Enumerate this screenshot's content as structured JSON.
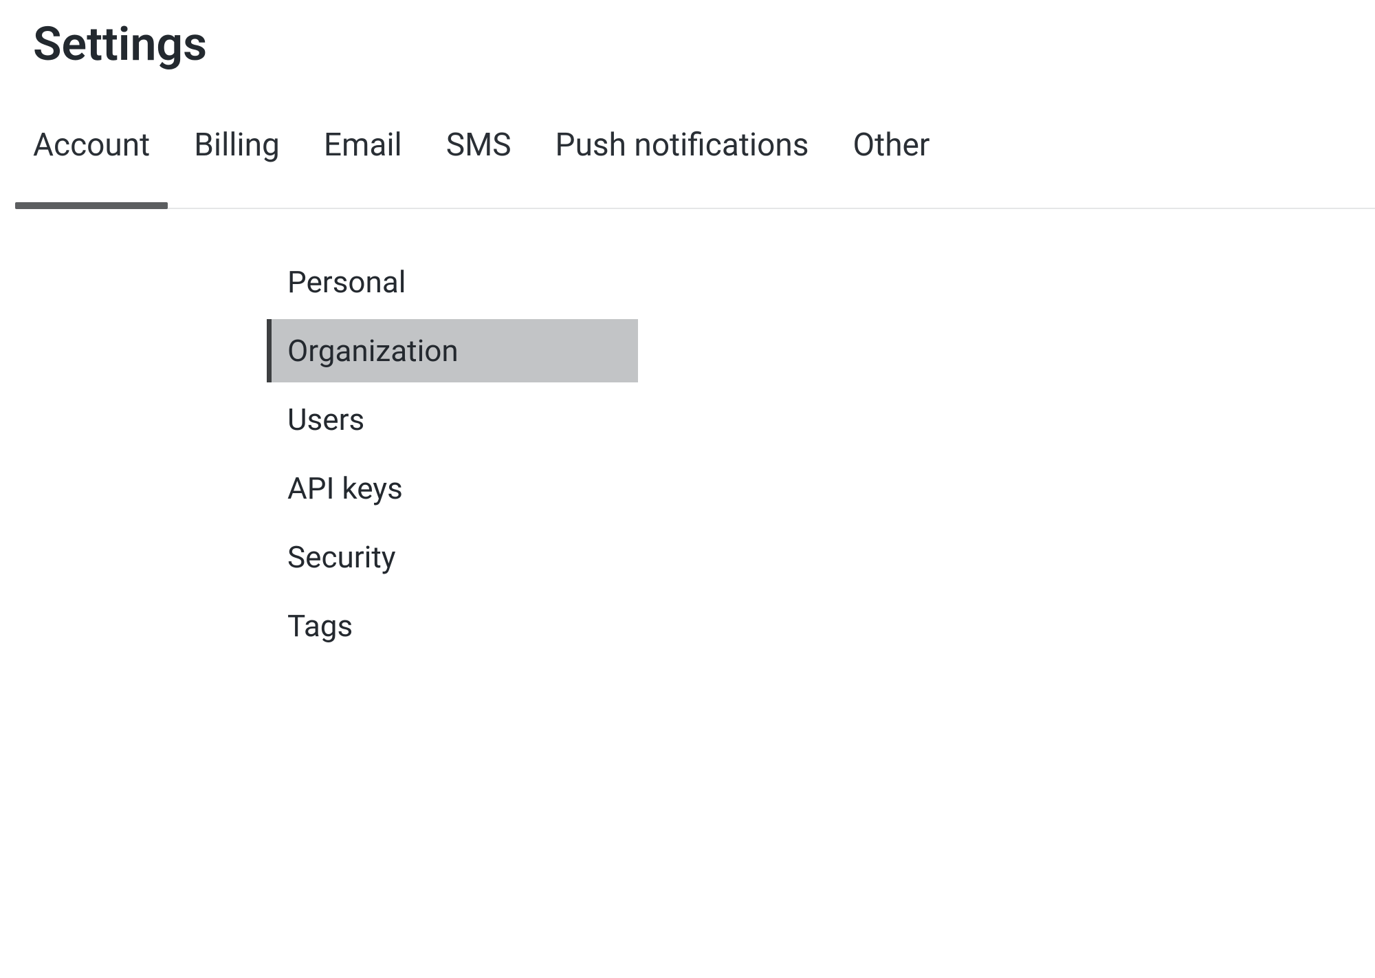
{
  "header": {
    "title": "Settings"
  },
  "tabs": [
    {
      "label": "Account",
      "active": true
    },
    {
      "label": "Billing",
      "active": false
    },
    {
      "label": "Email",
      "active": false
    },
    {
      "label": "SMS",
      "active": false
    },
    {
      "label": "Push notifications",
      "active": false
    },
    {
      "label": "Other",
      "active": false
    }
  ],
  "sidebar": {
    "items": [
      {
        "label": "Personal",
        "selected": false
      },
      {
        "label": "Organization",
        "selected": true
      },
      {
        "label": "Users",
        "selected": false
      },
      {
        "label": "API keys",
        "selected": false
      },
      {
        "label": "Security",
        "selected": false
      },
      {
        "label": "Tags",
        "selected": false
      }
    ]
  }
}
